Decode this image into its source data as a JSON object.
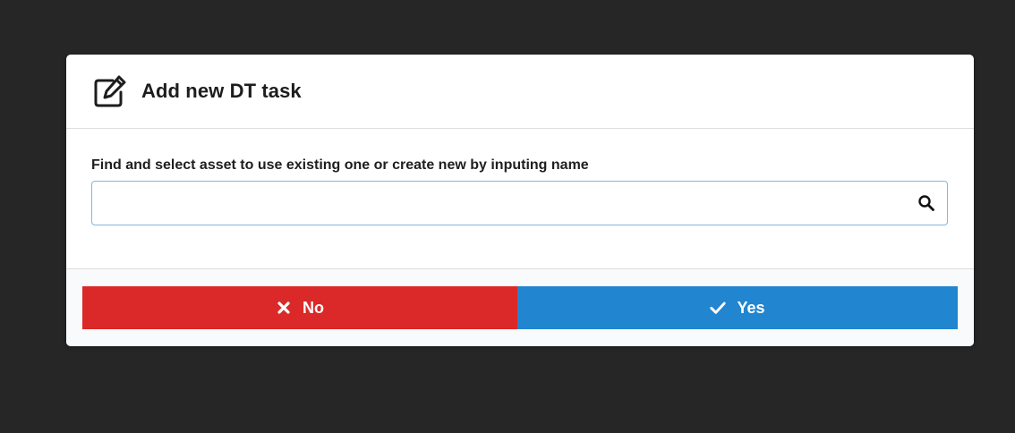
{
  "modal": {
    "title": "Add new DT task",
    "title_icon": "edit-icon"
  },
  "form": {
    "label": "Find and select asset to use existing one or create new by inputing name",
    "search_value": "",
    "search_placeholder": "",
    "search_icon": "search-icon"
  },
  "actions": {
    "no_label": "No",
    "no_icon": "close-icon",
    "no_color": "#db2828",
    "yes_label": "Yes",
    "yes_icon": "checkmark-icon",
    "yes_color": "#2185d0"
  }
}
